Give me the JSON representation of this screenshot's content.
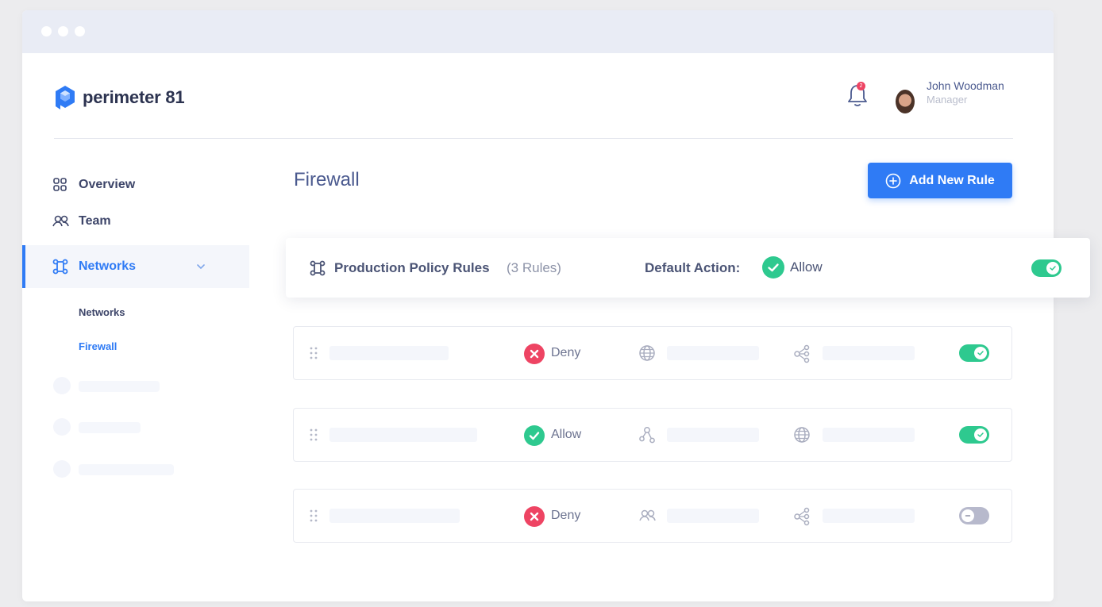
{
  "brand": {
    "name": "perimeter 81",
    "color": "#2f7bf5"
  },
  "header": {
    "notifications": {
      "icon": "bell-icon",
      "count": "2"
    },
    "user": {
      "name": "John Woodman",
      "role": "Manager"
    }
  },
  "sidebar": {
    "items": [
      {
        "label": "Overview",
        "icon": "grid-icon"
      },
      {
        "label": "Team",
        "icon": "team-icon"
      },
      {
        "label": "Networks",
        "icon": "network-icon",
        "active": true,
        "expanded": true
      }
    ],
    "sub_items": [
      {
        "label": "Networks",
        "active": false
      },
      {
        "label": "Firewall",
        "active": true
      }
    ]
  },
  "main": {
    "title": "Firewall",
    "add_button": "Add New Rule",
    "policy": {
      "title": "Production Policy Rules",
      "count": "(3 Rules)",
      "default_label": "Default Action:",
      "default_action": "Allow",
      "enabled": true
    },
    "rules": [
      {
        "action": "Deny",
        "action_type": "deny",
        "source_icon": "globe-icon",
        "dest_icon": "nodes-icon",
        "enabled": true
      },
      {
        "action": "Allow",
        "action_type": "allow",
        "source_icon": "network-share-icon",
        "dest_icon": "globe-icon",
        "enabled": true
      },
      {
        "action": "Deny",
        "action_type": "deny",
        "source_icon": "team-icon",
        "dest_icon": "nodes-icon",
        "enabled": false
      }
    ]
  },
  "colors": {
    "allow": "#2ec98f",
    "deny": "#ee4463",
    "accent": "#2f7bf5"
  }
}
